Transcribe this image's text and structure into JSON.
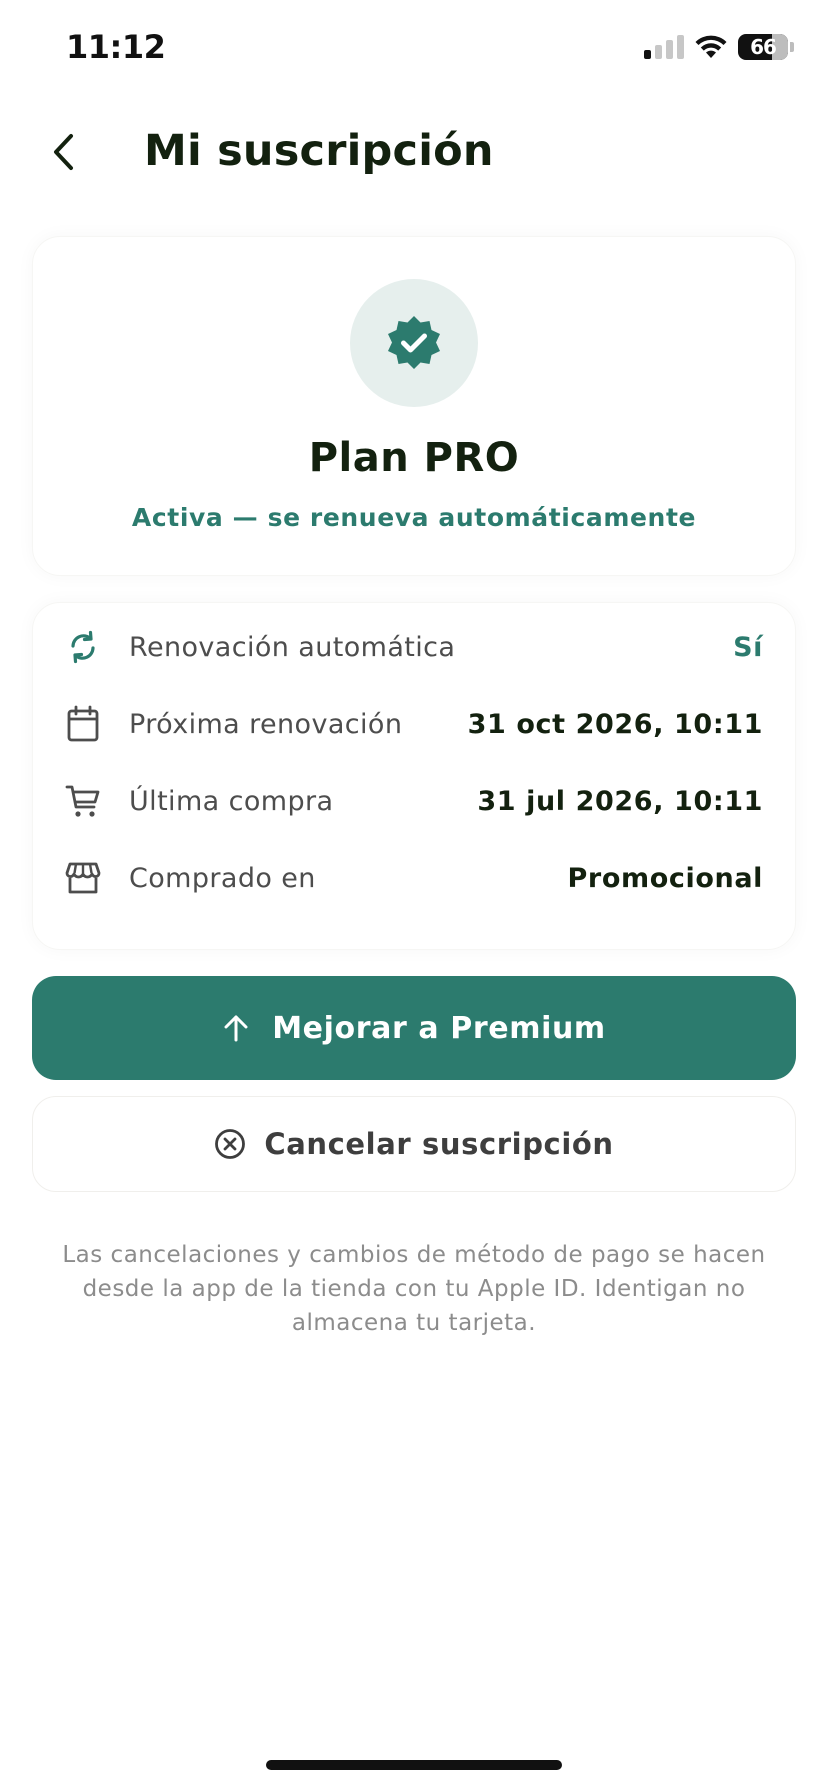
{
  "status_bar": {
    "time": "11:12",
    "battery": "66"
  },
  "header": {
    "title": "Mi suscripción"
  },
  "plan": {
    "name": "Plan PRO",
    "status": "Activa — se renueva automáticamente",
    "badge_icon": "verified-badge-icon"
  },
  "details": [
    {
      "icon": "refresh-icon",
      "label": "Renovación automática",
      "value": "Sí"
    },
    {
      "icon": "calendar-icon",
      "label": "Próxima renovación",
      "value": "31 oct 2026, 10:11"
    },
    {
      "icon": "cart-icon",
      "label": "Última compra",
      "value": "31 jul 2026, 10:11"
    },
    {
      "icon": "store-icon",
      "label": "Comprado en",
      "value": "Promocional"
    }
  ],
  "actions": {
    "upgrade_label": "Mejorar a Premium",
    "cancel_label": "Cancelar suscripción"
  },
  "footnote": "Las cancelaciones y cambios de método de pago se hacen desde la app de la tienda con tu Apple ID. Identigan no almacena tu tarjeta.",
  "colors": {
    "accent": "#2c7b6e",
    "badge_background": "#e6efed",
    "title_text": "#13210f"
  }
}
